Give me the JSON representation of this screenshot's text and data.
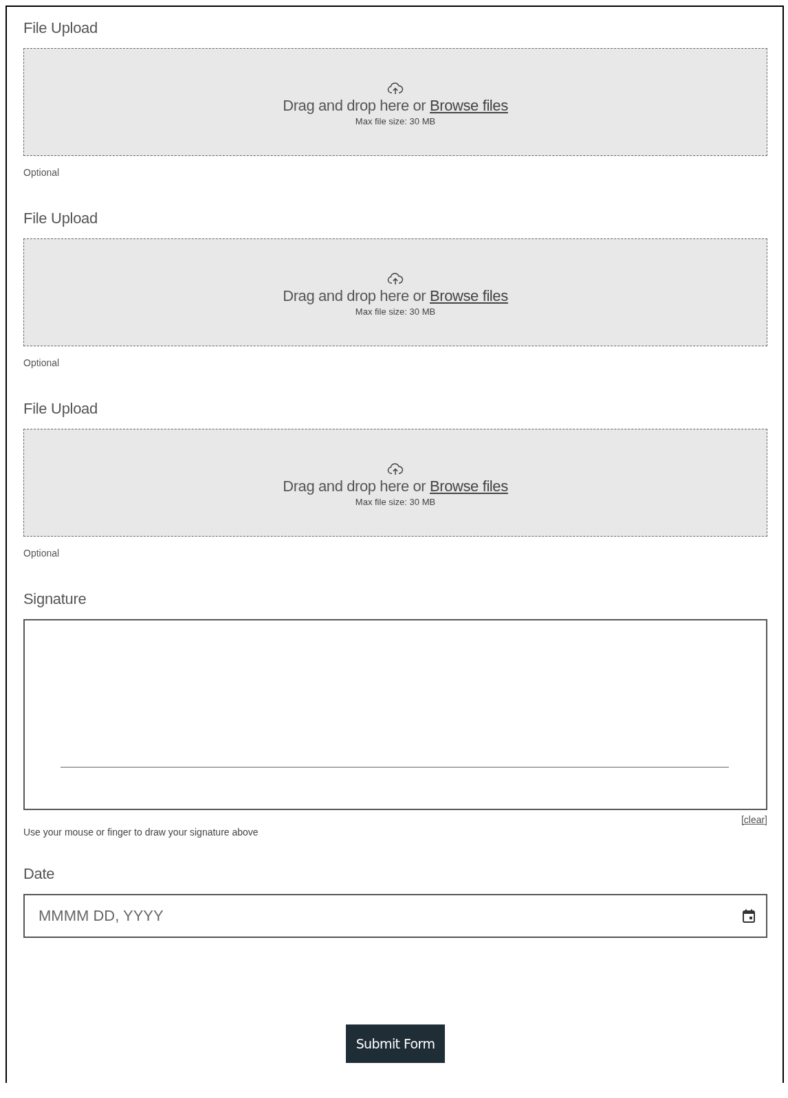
{
  "uploads": [
    {
      "label": "File Upload",
      "prompt": "Drag and drop here or",
      "link": "Browse files",
      "max_size": "Max file size: 30 MB",
      "hint": "Optional"
    },
    {
      "label": "File Upload",
      "prompt": "Drag and drop here or",
      "link": "Browse files",
      "max_size": "Max file size: 30 MB",
      "hint": "Optional"
    },
    {
      "label": "File Upload",
      "prompt": "Drag and drop here or",
      "link": "Browse files",
      "max_size": "Max file size: 30 MB",
      "hint": "Optional"
    }
  ],
  "signature": {
    "label": "Signature",
    "clear": "[clear]",
    "hint": "Use your mouse or finger to draw your signature above"
  },
  "date": {
    "label": "Date",
    "placeholder": "MMMM DD, YYYY"
  },
  "submit": "Submit Form"
}
